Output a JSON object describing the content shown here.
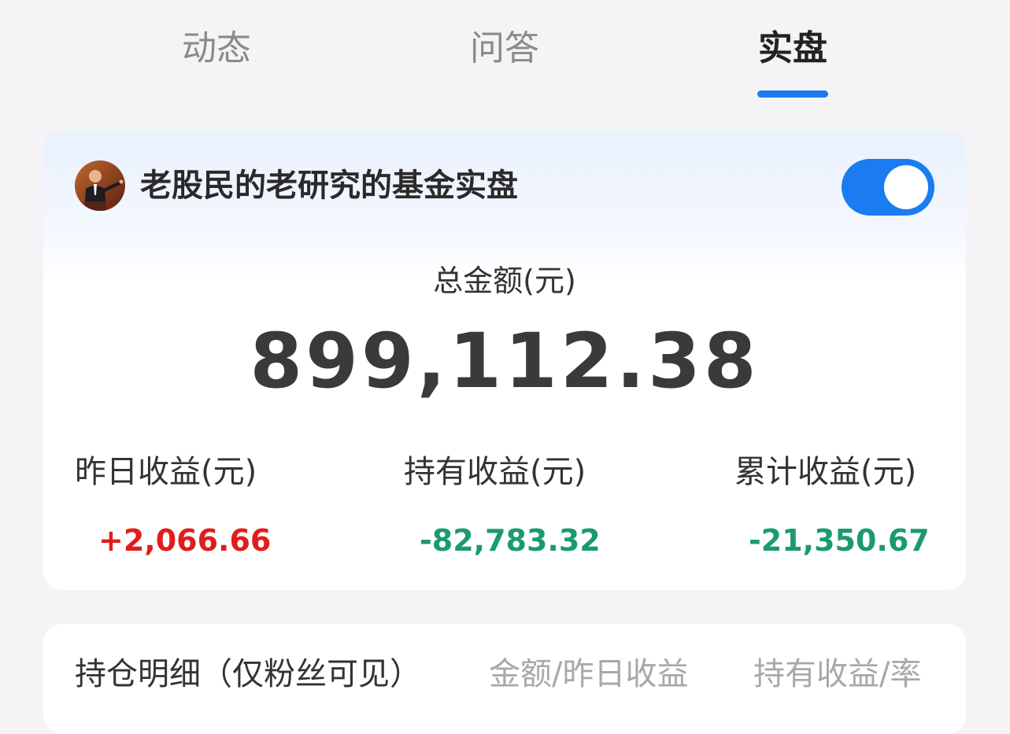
{
  "tabs": [
    {
      "label": "动态"
    },
    {
      "label": "问答"
    },
    {
      "label": "实盘",
      "active": true
    }
  ],
  "account": {
    "name": "老股民的老研究的基金实盘",
    "toggle_on": true
  },
  "summary": {
    "total_label": "总金额(元)",
    "total_value": "899,112.38"
  },
  "stats": [
    {
      "label": "昨日收益(元)",
      "value": "+2,066.66"
    },
    {
      "label": "持有收益(元)",
      "value": "-82,783.32"
    },
    {
      "label": "累计收益(元)",
      "value": "-21,350.67"
    }
  ],
  "holdings": {
    "title": "持仓明细（仅粉丝可见）",
    "columns": [
      "金额/昨日收益",
      "持有收益/率"
    ]
  },
  "colors": {
    "accent": "#1a7cf0",
    "gain": "#e21c1c",
    "loss": "#1b9a72"
  }
}
